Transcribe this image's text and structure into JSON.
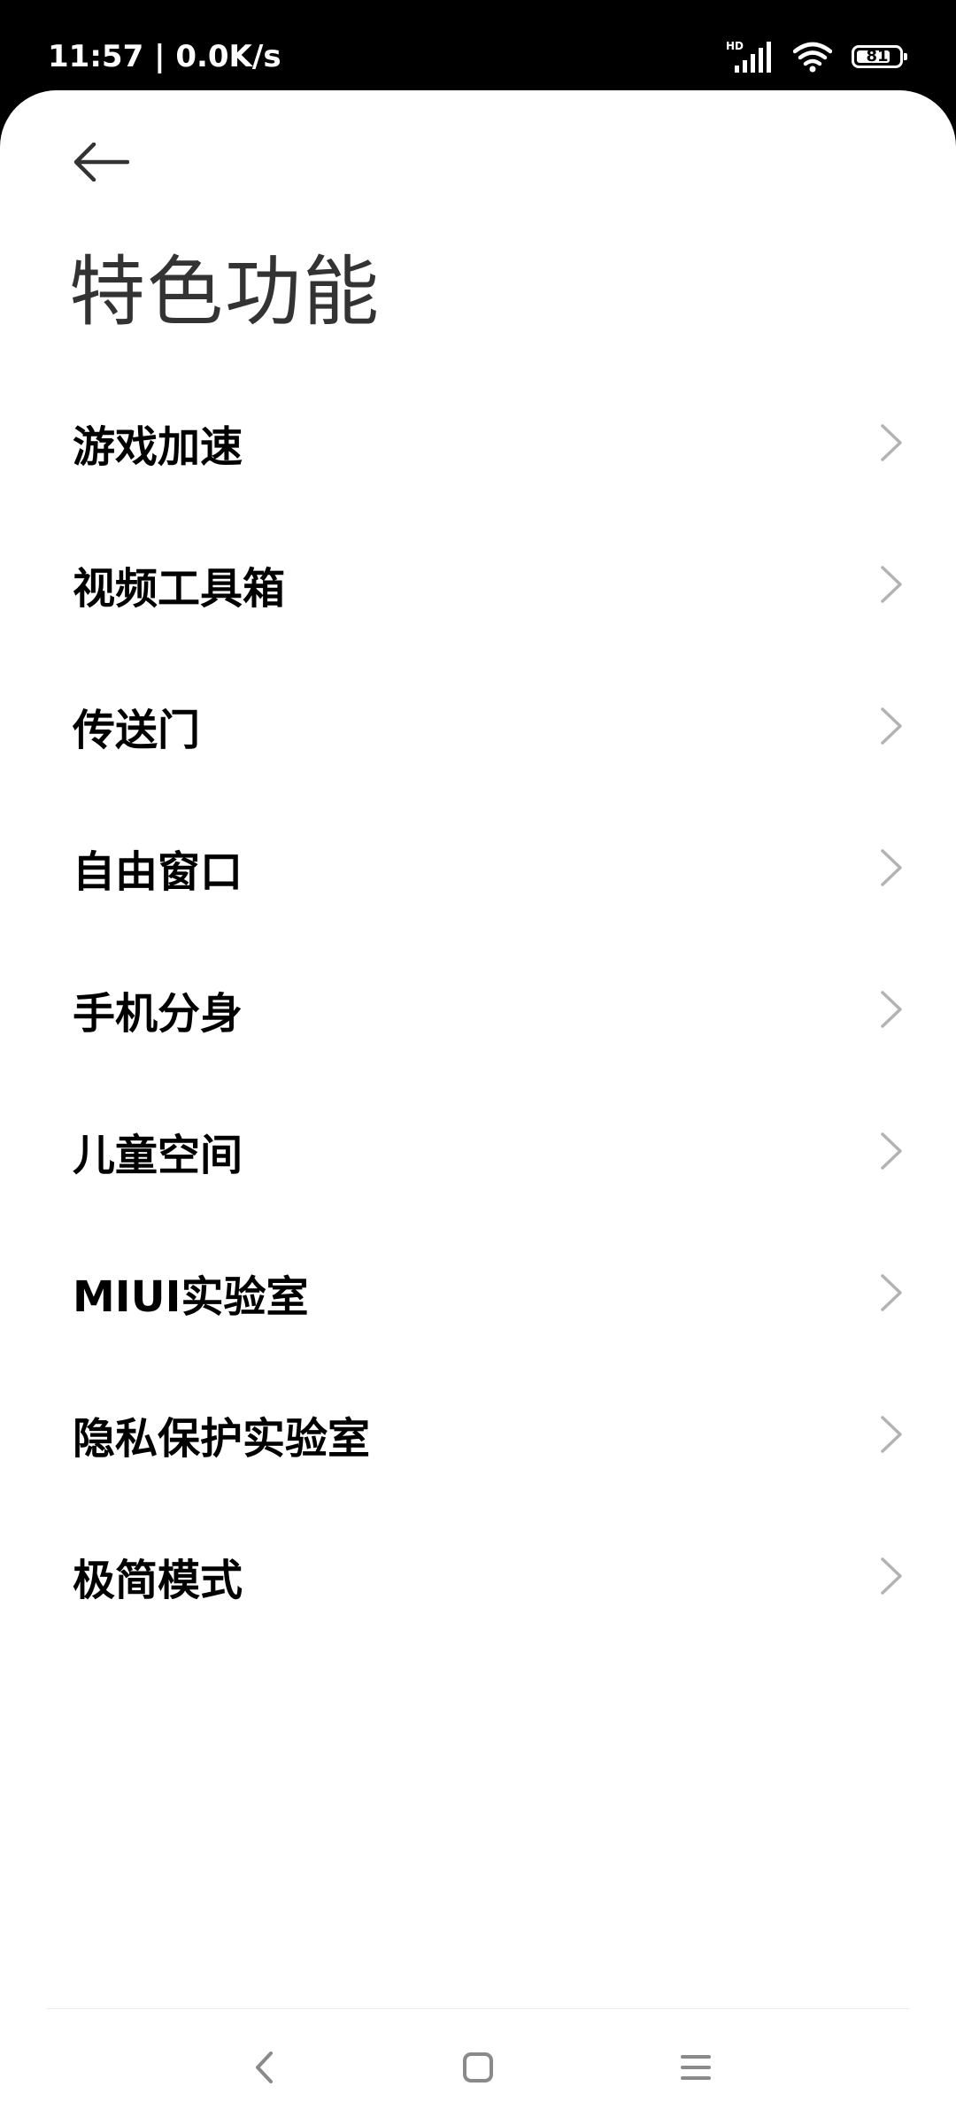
{
  "status_bar": {
    "time_and_speed": "11:57 | 0.0K/s",
    "network_label": "HD",
    "battery_level": "81",
    "battery_fraction": 0.81
  },
  "header": {
    "back_icon": "arrow-left-icon",
    "title": "特色功能"
  },
  "menu": {
    "items": [
      {
        "label": "游戏加速"
      },
      {
        "label": "视频工具箱"
      },
      {
        "label": "传送门"
      },
      {
        "label": "自由窗口"
      },
      {
        "label": "手机分身"
      },
      {
        "label": "儿童空间"
      },
      {
        "label": "MIUI实验室"
      },
      {
        "label": "隐私保护实验室"
      },
      {
        "label": "极简模式"
      }
    ],
    "chevron_icon": "chevron-right-icon"
  },
  "nav_bar": {
    "back_icon": "nav-back-icon",
    "home_icon": "nav-home-icon",
    "recents_icon": "nav-recents-icon"
  },
  "colors": {
    "status_bar_bg": "#000000",
    "page_bg": "#ffffff",
    "title_text": "#333333",
    "item_text": "#000000",
    "chevron": "#b3b3b3",
    "nav_icon": "#8a8a8a"
  }
}
